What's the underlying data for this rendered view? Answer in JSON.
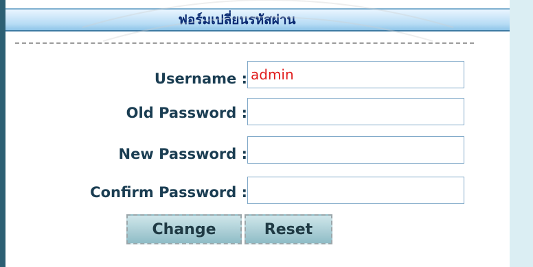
{
  "form": {
    "title": "ฟอร์มเปลี่ยนรหัสผ่าน",
    "fields": [
      {
        "label": "Username :",
        "value": "admin"
      },
      {
        "label": "Old Password :",
        "value": ""
      },
      {
        "label": "New Password :",
        "value": ""
      },
      {
        "label": "Confirm Password :",
        "value": ""
      }
    ],
    "buttons": {
      "change_label": "Change",
      "reset_label": "Reset"
    }
  },
  "colors": {
    "title_text": "#0a2a72",
    "label_text": "#1a3d52",
    "username_value": "#e01b1b",
    "field_border": "#7fa8c8",
    "title_bar": "#b7dcf5",
    "left_bar": "#2c5f73",
    "button_bg": "#8fbcc6"
  }
}
